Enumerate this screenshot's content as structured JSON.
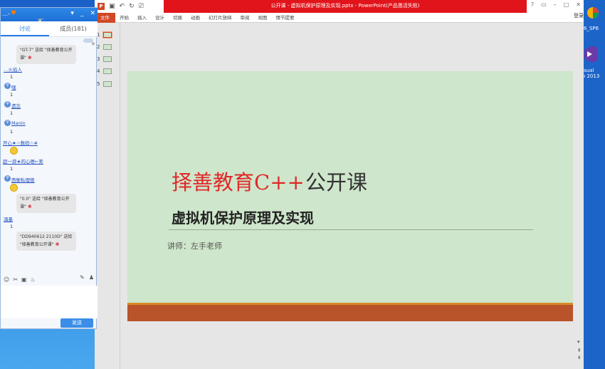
{
  "desktop": {
    "sp6_label": "6_SP6",
    "vs_label_1": "sual",
    "vs_label_2": "io 2013"
  },
  "ppt": {
    "window_title": "公开课 - 虚拟机保护原理及实现.pptx - PowerPoint(产品激活失败)",
    "login": "登录",
    "win_help": "?",
    "win_minimize": "–",
    "win_restore": "□",
    "win_close": "✕",
    "ribbon_tabs": [
      "文件",
      "开始",
      "插入",
      "设计",
      "切换",
      "动画",
      "幻灯片放映",
      "审阅",
      "视图",
      "情节提要"
    ],
    "slides": [
      "1",
      "2",
      "3",
      "4",
      "5"
    ],
    "slide": {
      "title_red": "择善教育C++",
      "title_dark": "公开课",
      "subtitle": "虚拟机保护原理及实现",
      "lecturer": "讲师：左手老师"
    }
  },
  "chat": {
    "title": "…-",
    "tabs": [
      "讨论",
      "成员(181)"
    ],
    "gift_msg_1": "\"GT-7\" 送给 \"择善教育公开课\"",
    "user_1": "…火焰人",
    "num_1": "1",
    "user_2": "嘿",
    "num_2": "1",
    "user_3": "遗忘",
    "num_3": "1",
    "user_4": "Manin",
    "num_4": "1",
    "user_5": "开心★☆数码☆#",
    "user_6": "超一蒜★的心嗯←美",
    "num_6": "1",
    "user_7": "西衡私理德",
    "gift_msg_2": "\"0.0\" 送给 \"择善教育公开课\"",
    "user_8": "涌墨",
    "num_8": "1",
    "gift_msg_3": "\"DD940612 2110D\" 送给 \"择善教育公开课\"",
    "send_label": "发送",
    "avatar_text": "字"
  }
}
